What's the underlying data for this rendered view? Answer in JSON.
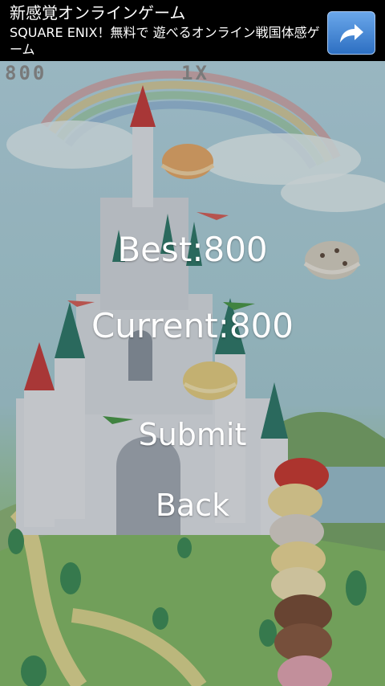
{
  "ad": {
    "title": "新感覚オンラインゲーム",
    "text": "SQUARE ENIX！無料で 遊べるオンライン戦国体感ゲーム",
    "button_icon": "share-arrow-icon"
  },
  "hud": {
    "score": "800",
    "multiplier": "1X"
  },
  "menu": {
    "best": "Best:800",
    "current": "Current:800",
    "submit": "Submit",
    "back": "Back"
  },
  "colors": {
    "ad_background": "#000000",
    "ad_button": "#3f7fd0",
    "hud_text": "#8f8f8f",
    "menu_text": "#ffffff",
    "sky": "#b6d8e6",
    "grass": "#86bb6f"
  }
}
